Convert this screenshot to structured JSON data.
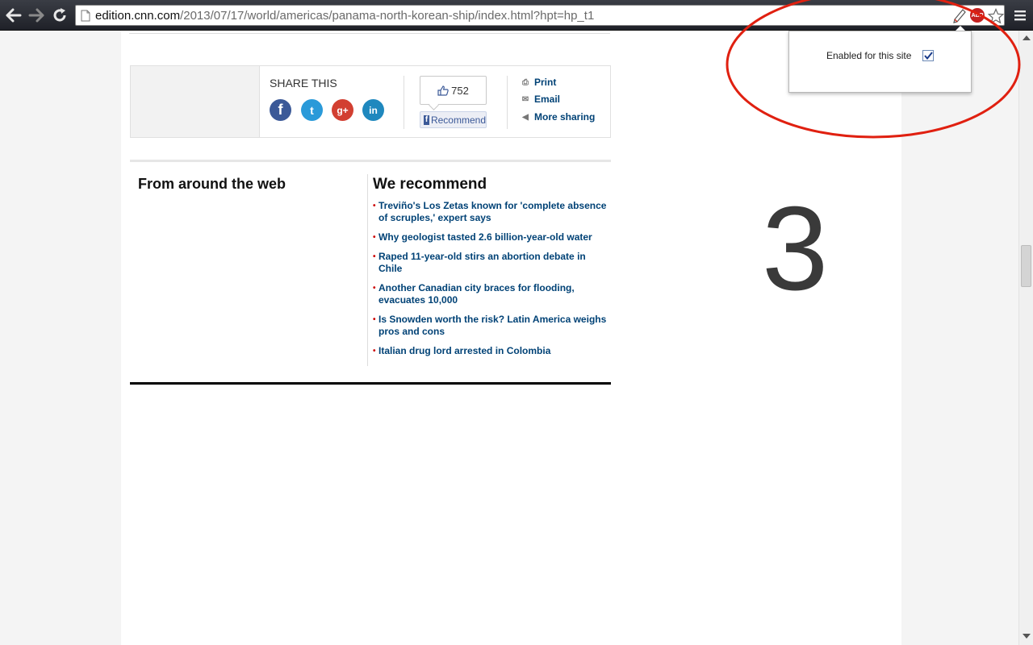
{
  "browser": {
    "url_host": "edition.cnn.com",
    "url_path": "/2013/07/17/world/americas/panama-north-korean-ship/index.html?hpt=hp_t1",
    "ext_abp_label": "ABP"
  },
  "popup": {
    "label": "Enabled for this site",
    "checked": true
  },
  "share": {
    "title": "SHARE THIS",
    "like_count": "752",
    "recommend_label": "Recommend",
    "links": [
      {
        "label": "Print"
      },
      {
        "label": "Email"
      },
      {
        "label": "More sharing"
      }
    ],
    "social": [
      "f",
      "t",
      "g+",
      "in"
    ]
  },
  "sections": {
    "left_title": "From around the web",
    "right_title": "We recommend",
    "recommend_items": [
      "Treviño's Los Zetas known for 'complete absence of scruples,' expert says",
      "Why geologist tasted 2.6 billion-year-old water",
      "Raped 11-year-old stirs an abortion debate in Chile",
      "Another Canadian city braces for flooding, evacuates 10,000",
      "Is Snowden worth the risk? Latin America weighs pros and cons",
      "Italian drug lord arrested in Colombia"
    ]
  },
  "annotation": {
    "step_number": "3",
    "circle_color": "#e02010"
  }
}
